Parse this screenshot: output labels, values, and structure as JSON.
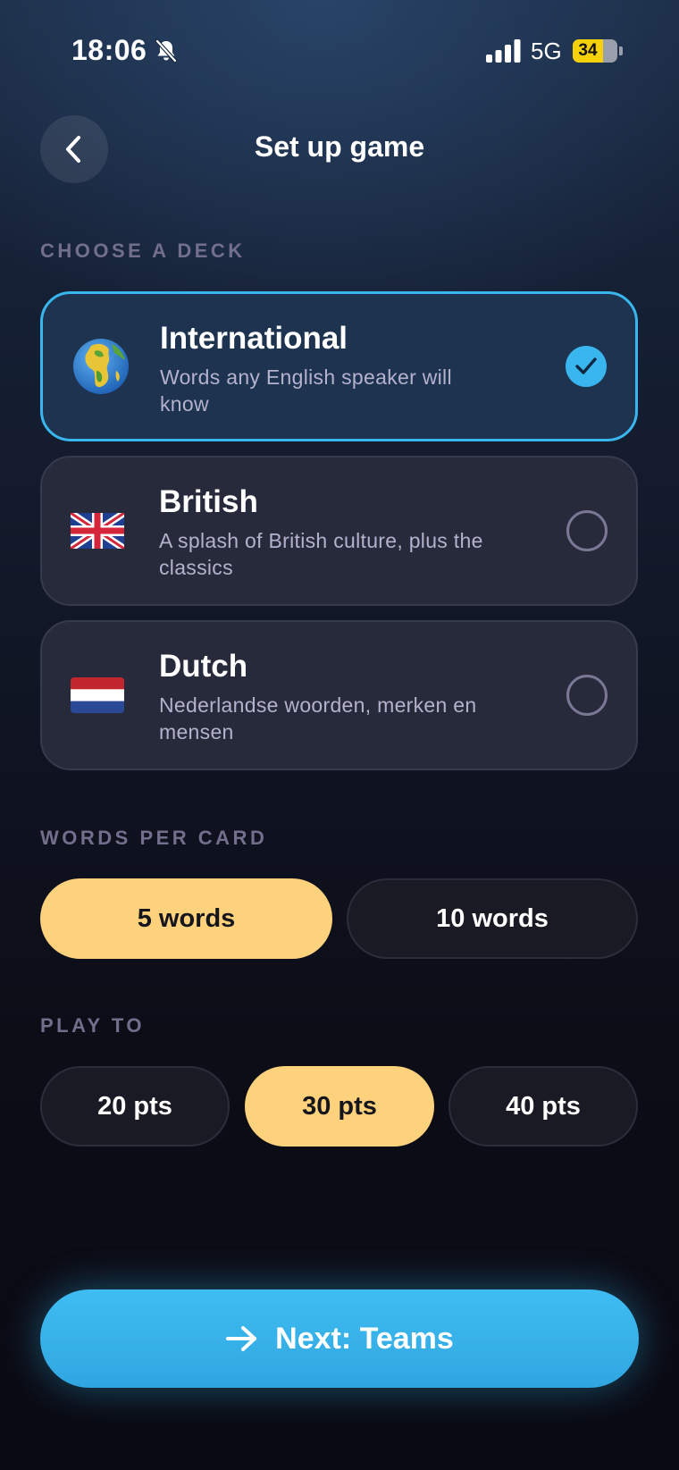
{
  "status_bar": {
    "time": "18:06",
    "network": "5G",
    "battery_level": "34",
    "icons": [
      "bell-muted-icon",
      "cellular-signal-icon",
      "battery-icon"
    ]
  },
  "header": {
    "title": "Set up game",
    "back_icon": "chevron-left-icon"
  },
  "deck_section": {
    "label": "CHOOSE A DECK",
    "decks": [
      {
        "name": "International",
        "description": "Words any English speaker will know",
        "icon": "globe-icon",
        "selected": true
      },
      {
        "name": "British",
        "description": "A splash of British culture, plus the classics",
        "icon": "uk-flag-icon",
        "selected": false
      },
      {
        "name": "Dutch",
        "description": "Nederlandse woorden, merken en mensen",
        "icon": "netherlands-flag-icon",
        "selected": false
      }
    ]
  },
  "words_section": {
    "label": "WORDS PER CARD",
    "options": [
      {
        "label": "5 words",
        "active": true
      },
      {
        "label": "10 words",
        "active": false
      }
    ]
  },
  "play_to_section": {
    "label": "PLAY TO",
    "options": [
      {
        "label": "20 pts",
        "active": false
      },
      {
        "label": "30 pts",
        "active": true
      },
      {
        "label": "40 pts",
        "active": false
      }
    ]
  },
  "next_button": {
    "label": "Next: Teams",
    "icon": "arrow-right-icon"
  },
  "colors": {
    "accent": "#3ab6ef",
    "selected_pill": "#fed27d",
    "card": "#272a3b",
    "section_label": "#716f8c"
  }
}
